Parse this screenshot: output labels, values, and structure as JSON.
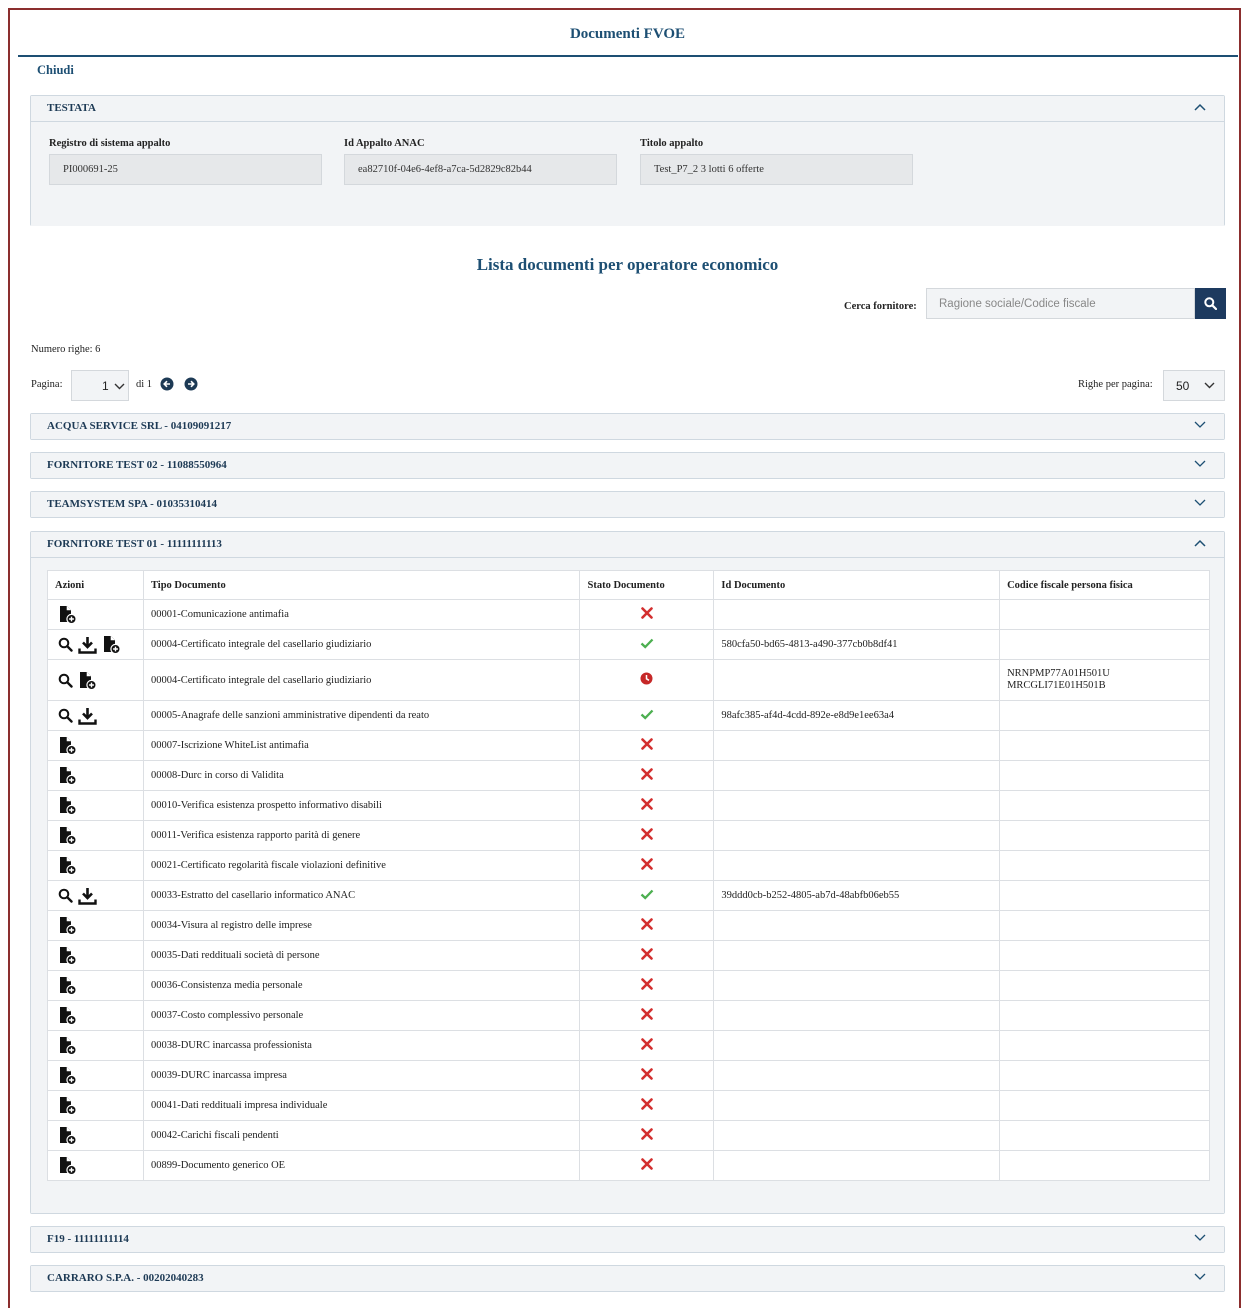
{
  "header": {
    "title": "Documenti FVOE",
    "close_label": "Chiudi"
  },
  "testata": {
    "title": "TESTATA",
    "fields": [
      {
        "label": "Registro di sistema appalto",
        "value": "PI000691-25"
      },
      {
        "label": "Id Appalto ANAC",
        "value": "ea82710f-04e6-4ef8-a7ca-5d2829c82b44"
      },
      {
        "label": "Titolo appalto",
        "value": "Test_P7_2 3 lotti 6 offerte"
      }
    ]
  },
  "list": {
    "title": "Lista documenti per operatore economico",
    "search_label": "Cerca fornitore:",
    "search_placeholder": "Ragione sociale/Codice fiscale",
    "rows_count": "Numero righe: 6",
    "page_label": "Pagina:",
    "page_value": "1",
    "page_of": "di 1",
    "rows_per_page_label": "Righe per pagina:",
    "rows_per_page_value": "50"
  },
  "operators": [
    {
      "name": "ACQUA SERVICE SRL - 04109091217",
      "expanded": false
    },
    {
      "name": "FORNITORE TEST 02 - 11088550964",
      "expanded": false
    },
    {
      "name": "TEAMSYSTEM SPA - 01035310414",
      "expanded": false
    },
    {
      "name": "FORNITORE TEST 01 - 11111111113",
      "expanded": true
    },
    {
      "name": "F19 - 11111111114",
      "expanded": false
    },
    {
      "name": "CARRARO S.P.A. - 00202040283",
      "expanded": false
    }
  ],
  "table": {
    "headers": [
      "Azioni",
      "Tipo Documento",
      "Stato Documento",
      "Id Documento",
      "Codice fiscale persona fisica"
    ],
    "rows": [
      {
        "actions": [
          "add"
        ],
        "type": "00001-Comunicazione antimafia",
        "status": "missing",
        "id": "",
        "cf": []
      },
      {
        "actions": [
          "view",
          "download",
          "add"
        ],
        "type": "00004-Certificato integrale del casellario giudiziario",
        "status": "ok",
        "id": "580cfa50-bd65-4813-a490-377cb0b8df41",
        "cf": []
      },
      {
        "actions": [
          "view",
          "add"
        ],
        "type": "00004-Certificato integrale del casellario giudiziario",
        "status": "pending",
        "id": "",
        "cf": [
          "NRNPMP77A01H501U",
          "MRCGLI71E01H501B"
        ]
      },
      {
        "actions": [
          "view",
          "download"
        ],
        "type": "00005-Anagrafe delle sanzioni amministrative dipendenti da reato",
        "status": "ok",
        "id": "98afc385-af4d-4cdd-892e-e8d9e1ee63a4",
        "cf": []
      },
      {
        "actions": [
          "add"
        ],
        "type": "00007-Iscrizione WhiteList antimafia",
        "status": "missing",
        "id": "",
        "cf": []
      },
      {
        "actions": [
          "add"
        ],
        "type": "00008-Durc in corso di Validita",
        "status": "missing",
        "id": "",
        "cf": []
      },
      {
        "actions": [
          "add"
        ],
        "type": "00010-Verifica esistenza prospetto informativo disabili",
        "status": "missing",
        "id": "",
        "cf": []
      },
      {
        "actions": [
          "add"
        ],
        "type": "00011-Verifica esistenza rapporto parità di genere",
        "status": "missing",
        "id": "",
        "cf": []
      },
      {
        "actions": [
          "add"
        ],
        "type": "00021-Certificato regolarità fiscale violazioni definitive",
        "status": "missing",
        "id": "",
        "cf": []
      },
      {
        "actions": [
          "view",
          "download"
        ],
        "type": "00033-Estratto del casellario informatico ANAC",
        "status": "ok",
        "id": "39ddd0cb-b252-4805-ab7d-48abfb06eb55",
        "cf": []
      },
      {
        "actions": [
          "add"
        ],
        "type": "00034-Visura al registro delle imprese",
        "status": "missing",
        "id": "",
        "cf": []
      },
      {
        "actions": [
          "add"
        ],
        "type": "00035-Dati reddituali società di persone",
        "status": "missing",
        "id": "",
        "cf": []
      },
      {
        "actions": [
          "add"
        ],
        "type": "00036-Consistenza media personale",
        "status": "missing",
        "id": "",
        "cf": []
      },
      {
        "actions": [
          "add"
        ],
        "type": "00037-Costo complessivo personale",
        "status": "missing",
        "id": "",
        "cf": []
      },
      {
        "actions": [
          "add"
        ],
        "type": "00038-DURC inarcassa professionista",
        "status": "missing",
        "id": "",
        "cf": []
      },
      {
        "actions": [
          "add"
        ],
        "type": "00039-DURC inarcassa impresa",
        "status": "missing",
        "id": "",
        "cf": []
      },
      {
        "actions": [
          "add"
        ],
        "type": "00041-Dati reddituali impresa individuale",
        "status": "missing",
        "id": "",
        "cf": []
      },
      {
        "actions": [
          "add"
        ],
        "type": "00042-Carichi fiscali pendenti",
        "status": "missing",
        "id": "",
        "cf": []
      },
      {
        "actions": [
          "add"
        ],
        "type": "00899-Documento generico OE",
        "status": "missing",
        "id": "",
        "cf": []
      }
    ]
  },
  "colors": {
    "brand": "#1d4f73",
    "ok": "#4caf50",
    "missing": "#d32f2f",
    "pending": "#c62828",
    "search_button": "#1d3a5f"
  }
}
